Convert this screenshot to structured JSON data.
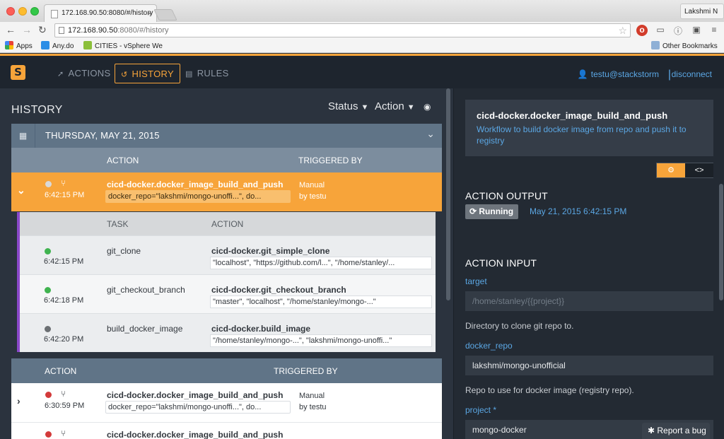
{
  "browser": {
    "tab_title": "172.168.90.50:8080/#/history",
    "url_host": "172.168.90.50",
    "url_rest": ":8080/#/history",
    "profile_name": "Lakshmi N",
    "bookmarks": [
      "Apps",
      "Any.do",
      "CITIES - vSphere We"
    ],
    "other_bookmarks": "Other Bookmarks"
  },
  "header": {
    "nav": [
      {
        "label": "ACTIONS",
        "icon": "rocket-icon"
      },
      {
        "label": "HISTORY",
        "icon": "history-icon",
        "active": true
      },
      {
        "label": "RULES",
        "icon": "book-icon"
      }
    ],
    "user": "testu@stackstorm",
    "separator": "|",
    "disconnect": "disconnect"
  },
  "history": {
    "title": "HISTORY",
    "filters": {
      "status": "Status",
      "action": "Action"
    },
    "day_label": "THURSDAY, MAY 21, 2015",
    "columns": {
      "action": "ACTION",
      "triggered_by": "TRIGGERED BY"
    },
    "executions": [
      {
        "status": "running",
        "time": "6:42:15 PM",
        "action": "cicd-docker.docker_image_build_and_push",
        "params": "docker_repo=\"lakshmi/mongo-unoffi...\", do...",
        "trigger_type": "Manual",
        "trigger_user": "by testu"
      },
      {
        "status": "failed",
        "time": "6:30:59 PM",
        "action": "cicd-docker.docker_image_build_and_push",
        "params": "docker_repo=\"lakshmi/mongo-unoffi...\", do...",
        "trigger_type": "Manual",
        "trigger_user": "by testu"
      },
      {
        "status": "failed",
        "action": "cicd-docker.docker_image_build_and_push"
      }
    ],
    "child_columns": {
      "task": "TASK",
      "action": "ACTION"
    },
    "children": [
      {
        "status": "succeeded",
        "time": "6:42:15 PM",
        "task": "git_clone",
        "action": "cicd-docker.git_simple_clone",
        "params": "\"localhost\", \"https://github.com/l...\", \"/home/stanley/..."
      },
      {
        "status": "succeeded",
        "time": "6:42:18 PM",
        "task": "git_checkout_branch",
        "action": "cicd-docker.git_checkout_branch",
        "params": "\"master\", \"localhost\", \"/home/stanley/mongo-...\""
      },
      {
        "status": "scheduled",
        "time": "6:42:20 PM",
        "task": "build_docker_image",
        "action": "cicd-docker.build_image",
        "params": "\"/home/stanley/mongo-...\", \"lakshmi/mongo-unoffi...\""
      }
    ]
  },
  "details": {
    "name": "cicd-docker.docker_image_build_and_push",
    "description": "Workflow to build docker image from repo and push it to registry",
    "output_title": "ACTION OUTPUT",
    "status_label": "Running",
    "timestamp": "May 21, 2015 6:42:15 PM",
    "input_title": "ACTION INPUT",
    "fields": [
      {
        "label": "target",
        "value": "/home/stanley/{{project}}",
        "help": "Directory to clone git repo to."
      },
      {
        "label": "docker_repo",
        "value": "lakshmi/mongo-unofficial",
        "help": "Repo to use for docker image (registry repo)."
      },
      {
        "label": "project *",
        "value": "mongo-docker"
      }
    ]
  },
  "report_bug": "Report a bug",
  "colors": {
    "accent": "#f7a43a",
    "link": "#5ba7e4",
    "success": "#3fb34f",
    "failed": "#d33b3b",
    "workflow_border": "#8a48c9"
  }
}
